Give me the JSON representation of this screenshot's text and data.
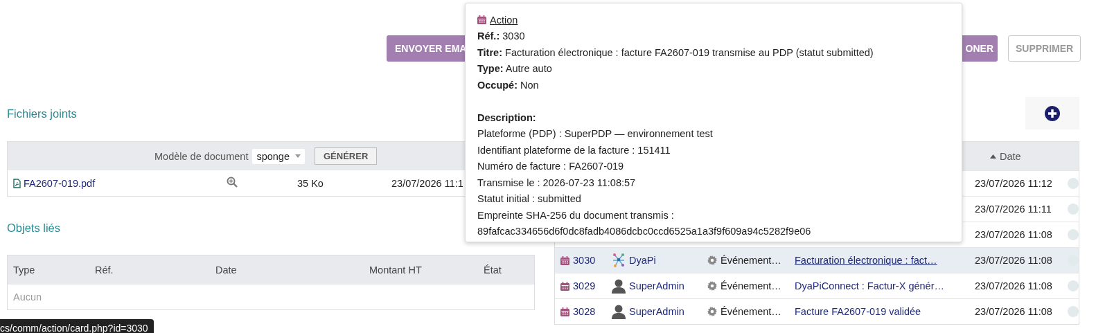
{
  "actions": [
    {
      "label": "ENVOYER EMA",
      "kind": "primary"
    },
    {
      "label": "ONER",
      "kind": "primary"
    },
    {
      "label": "SUPPRIMER",
      "kind": "outline"
    }
  ],
  "files": {
    "title": "Fichiers joints",
    "template_label": "Modèle de document",
    "template_value": "sponge",
    "generate_button": "GÉNÉRER",
    "rows": [
      {
        "name": "FA2607-019.pdf",
        "size": "35 Ko",
        "date": "23/07/2026 11:1"
      }
    ]
  },
  "linked": {
    "title": "Objets liés",
    "columns": [
      "Type",
      "Réf.",
      "Date",
      "Montant HT",
      "État"
    ],
    "empty": "Aucun"
  },
  "events": {
    "columns": [
      {
        "label": "Date",
        "sort_ascending": true
      }
    ],
    "rows": [
      {
        "date": "23/07/2026 11:12",
        "highlighted": false
      },
      {
        "date": "23/07/2026 11:11",
        "highlighted": false
      },
      {
        "date": "23/07/2026 11:08",
        "highlighted": false
      },
      {
        "ref": "3030",
        "author": {
          "name": "DyaPi",
          "kind": "bot"
        },
        "type": "Événement…",
        "title": "Facturation électronique : fact…",
        "date": "23/07/2026 11:08",
        "highlighted": true
      },
      {
        "ref": "3029",
        "author": {
          "name": "SuperAdmin",
          "kind": "user"
        },
        "type": "Événement…",
        "title": "DyaPiConnect : Factur-X génér…",
        "date": "23/07/2026 11:08",
        "highlighted": false
      },
      {
        "ref": "3028",
        "author": {
          "name": "SuperAdmin",
          "kind": "user"
        },
        "type": "Événement…",
        "title": "Facture FA2607-019 validée",
        "date": "23/07/2026 11:08",
        "highlighted": false
      }
    ]
  },
  "tooltip": {
    "heading": "Action",
    "fields": [
      "**Réf.:** 3030",
      "**Titre:** Facturation électronique : facture FA2607-019 transmise au PDP (statut submitted)",
      "**Type:** Autre auto",
      "**Occupé:** Non"
    ],
    "description_label": "Description:",
    "description": [
      "Plateforme (PDP) : SuperPDP — environnement test",
      "Identifiant plateforme de la facture : 151411",
      "Numéro de facture : FA2607-019",
      "Transmise le : 2026-07-23 11:08:57",
      "Statut initial : submitted",
      "Empreinte SHA-256 du document transmis :",
      "89fafcac334656d6f0dc8fadb4086dcbc0ccd6525a1a3f9f609a94c5282f9e06"
    ]
  },
  "status_url": "cs/comm/action/card.php?id=3030"
}
